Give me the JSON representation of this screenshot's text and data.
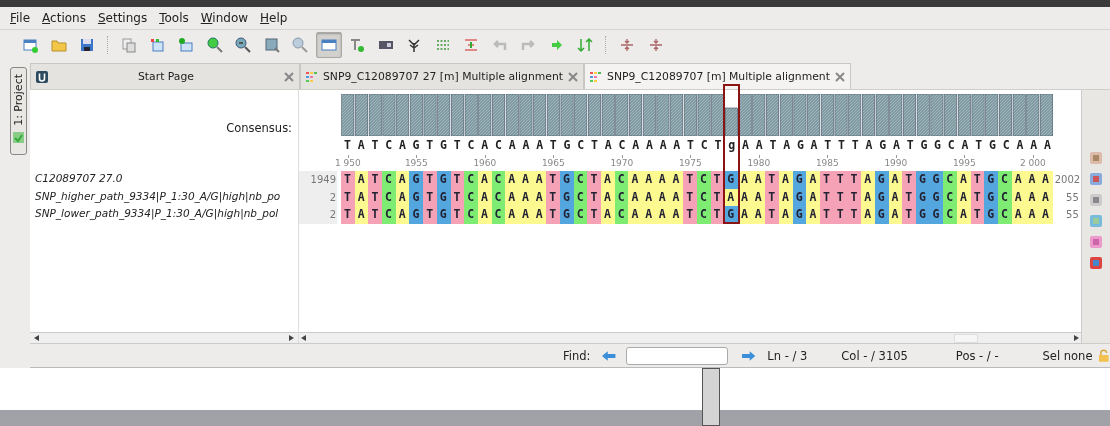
{
  "menu": [
    "File",
    "Actions",
    "Settings",
    "Tools",
    "Window",
    "Help"
  ],
  "toolbar": [
    {
      "kind": "new-window",
      "pressed": false
    },
    {
      "kind": "folder",
      "pressed": false
    },
    {
      "kind": "save",
      "pressed": false
    },
    {
      "kind": "separator"
    },
    {
      "kind": "copy",
      "pressed": false
    },
    {
      "kind": "add-sequence",
      "pressed": false
    },
    {
      "kind": "add-file",
      "pressed": false
    },
    {
      "kind": "zoom-in",
      "pressed": false
    },
    {
      "kind": "zoom-out",
      "pressed": false
    },
    {
      "kind": "zoom-fit",
      "pressed": false
    },
    {
      "kind": "zoom-reset",
      "pressed": false
    },
    {
      "kind": "overview",
      "pressed": true
    },
    {
      "kind": "text-add",
      "pressed": false
    },
    {
      "kind": "panel",
      "pressed": false
    },
    {
      "kind": "tree",
      "pressed": false
    },
    {
      "kind": "dots",
      "pressed": false
    },
    {
      "kind": "align",
      "pressed": false
    },
    {
      "kind": "undo",
      "pressed": false
    },
    {
      "kind": "redo",
      "pressed": false
    },
    {
      "kind": "green-arrow",
      "pressed": false
    },
    {
      "kind": "sort",
      "pressed": false
    },
    {
      "kind": "separator"
    },
    {
      "kind": "collapse",
      "pressed": false
    },
    {
      "kind": "collapse",
      "pressed": false
    }
  ],
  "side_panel": {
    "label": "1: Project"
  },
  "tabs": [
    {
      "kind": "start",
      "label": "Start Page",
      "selected": false
    },
    {
      "kind": "alignment",
      "label": "SNP9_C12089707 27 [m] Multiple alignment",
      "selected": false
    },
    {
      "kind": "alignment",
      "label": "SNP9_C12089707 [m] Multiple alignment",
      "selected": true
    }
  ],
  "alignment": {
    "consensus_label": "Consensus:",
    "consensus": "TATCAGTGTCACAAATGCTACAAAATCTgAATAGATTTAGATGGCATGCAAA",
    "ruler_ticks": [
      "1 950",
      "1955",
      "1960",
      "1965",
      "1970",
      "1975",
      "1980",
      "1985",
      "1990",
      "1995",
      "2 000"
    ],
    "rows": [
      {
        "name": "C12089707 27.0",
        "start": "1949",
        "sequence": "TATCAGTGTCACAAATGCTACAAAATCTGAATAGATTTAGATGGCATGCAAA",
        "end": "2002"
      },
      {
        "name": "SNP_higher_path_9334|P_1:30_A/G|high|nb_po",
        "start": "2",
        "sequence": "TATCAGTGTCACAAATGCTACAAAATCTAAATAGATTTAGATGGCATGCAAA",
        "end": "55"
      },
      {
        "name": "SNP_lower_path_9334|P_1:30_A/G|high|nb_pol",
        "start": "2",
        "sequence": "TATCAGTGTCACAAATGCTACAAAATCTGAATAGATTTAGATGGCATGCAAA",
        "end": "55"
      }
    ]
  },
  "find_bar": {
    "label": "Find:",
    "line": "Ln - / 3",
    "column": "Col - / 3105",
    "position": "Pos - / -",
    "selection": "Sel none"
  }
}
